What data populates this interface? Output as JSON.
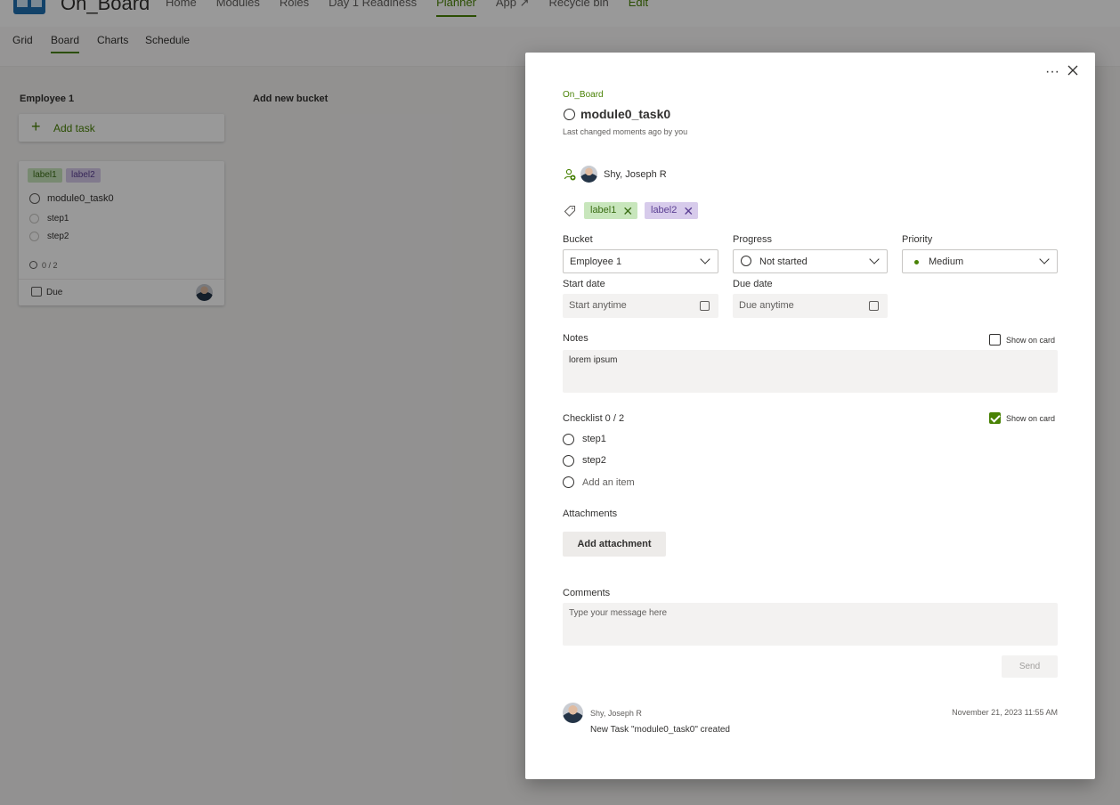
{
  "app": {
    "title": "On_Board",
    "nav": [
      "Home",
      "Modules",
      "Roles",
      "Day 1 Readiness",
      "Planner",
      "App ↗",
      "Recycle bin",
      "Edit"
    ],
    "active_nav": "Planner"
  },
  "subnav": {
    "tabs": [
      "Grid",
      "Board",
      "Charts",
      "Schedule"
    ],
    "active": "Board"
  },
  "board": {
    "bucket_name": "Employee 1",
    "add_task": "Add task",
    "add_bucket": "Add new bucket",
    "card": {
      "labels": [
        "label1",
        "label2"
      ],
      "title": "module0_task0",
      "steps": [
        "step1",
        "step2"
      ],
      "progress": "0 / 2",
      "due": "Due"
    }
  },
  "task": {
    "plan": "On_Board",
    "title": "module0_task0",
    "last_changed": "Last changed moments ago by you",
    "assignee": "Shy, Joseph R",
    "labels": [
      "label1",
      "label2"
    ],
    "bucket_label": "Bucket",
    "bucket_value": "Employee 1",
    "progress_label": "Progress",
    "progress_value": "Not started",
    "priority_label": "Priority",
    "priority_value": "Medium",
    "start_label": "Start date",
    "start_placeholder": "Start anytime",
    "due_label": "Due date",
    "due_placeholder": "Due anytime",
    "notes_label": "Notes",
    "notes_show_on_card": "Show on card",
    "notes_show_checked": false,
    "notes_value": "lorem ipsum",
    "checklist_label": "Checklist 0 / 2",
    "checklist_show_on_card": "Show on card",
    "checklist_show_checked": true,
    "checklist_items": [
      "step1",
      "step2"
    ],
    "add_item_placeholder": "Add an item",
    "attachments_label": "Attachments",
    "add_attachment": "Add attachment",
    "comments_label": "Comments",
    "comment_placeholder": "Type your message here",
    "send": "Send",
    "comment": {
      "author": "Shy, Joseph R",
      "date": "November 21, 2023 11:55 AM",
      "text": "New Task \"module0_task0\" created"
    }
  },
  "colors": {
    "accent": "#498205",
    "label1_bg": "#c8e6bc",
    "label2_bg": "#d7cbeb",
    "overlay": "rgba(0,0,0,0.4)"
  }
}
